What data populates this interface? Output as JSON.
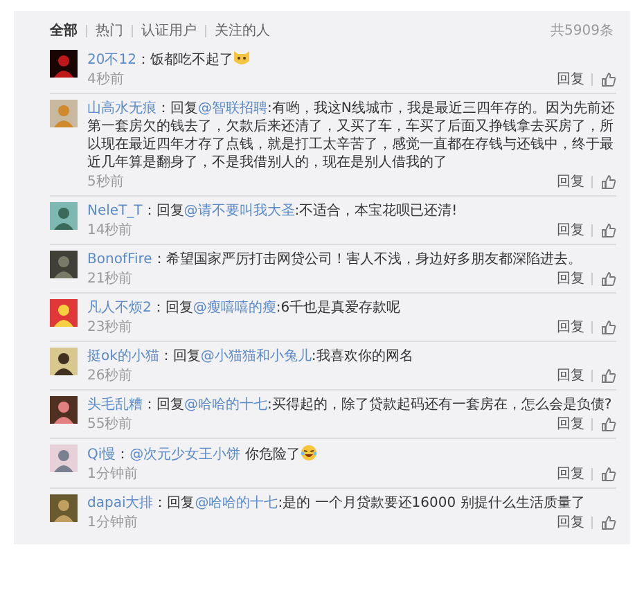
{
  "tabs": [
    {
      "label": "全部",
      "selected": true
    },
    {
      "label": "热门",
      "selected": false
    },
    {
      "label": "认证用户",
      "selected": false
    },
    {
      "label": "关注的人",
      "selected": false
    }
  ],
  "total": "共5909条",
  "comments": [
    {
      "user": "20不12",
      "parts": [
        {
          "kind": "text",
          "text": "：饭都吃不起了"
        },
        {
          "kind": "catface"
        }
      ],
      "time": "4秒前",
      "reply": "回复"
    },
    {
      "user": "山高水无痕",
      "parts": [
        {
          "kind": "text",
          "text": "：回复"
        },
        {
          "kind": "mention",
          "text": "@智联招聘"
        },
        {
          "kind": "text",
          "text": ":有哟，我这N线城市，我是最近三四年存的。因为先前还第一套房欠的钱去了，欠款后来还清了，又买了车，车买了后面又挣钱拿去买房了，所以现在最近四年才存了点钱，就是打工太辛苦了，感觉一直都在存钱与还钱中，终于最近几年算是翻身了，不是我借别人的，现在是别人借我的了"
        }
      ],
      "time": "5秒前",
      "reply": "回复"
    },
    {
      "user": "NeleT_T",
      "parts": [
        {
          "kind": "text",
          "text": "：回复"
        },
        {
          "kind": "mention",
          "text": "@请不要叫我大圣"
        },
        {
          "kind": "text",
          "text": ":不适合，本宝花呗已还清!"
        }
      ],
      "time": "14秒前",
      "reply": "回复"
    },
    {
      "user": "BonofFire",
      "parts": [
        {
          "kind": "text",
          "text": "：希望国家严厉打击网贷公司！害人不浅，身边好多朋友都深陷进去。"
        }
      ],
      "time": "21秒前",
      "reply": "回复"
    },
    {
      "user": "凡人不烦2",
      "parts": [
        {
          "kind": "text",
          "text": "：回复"
        },
        {
          "kind": "mention",
          "text": "@瘦嘻嘻的瘦"
        },
        {
          "kind": "text",
          "text": ":6千也是真爱存款呢"
        }
      ],
      "time": "23秒前",
      "reply": "回复"
    },
    {
      "user": "挺ok的小猫",
      "parts": [
        {
          "kind": "text",
          "text": "：回复"
        },
        {
          "kind": "mention",
          "text": "@小猫猫和小兔儿"
        },
        {
          "kind": "text",
          "text": ":我喜欢你的网名"
        }
      ],
      "time": "26秒前",
      "reply": "回复"
    },
    {
      "user": "头毛乱糟",
      "parts": [
        {
          "kind": "text",
          "text": "：回复"
        },
        {
          "kind": "mention",
          "text": "@哈哈的十七"
        },
        {
          "kind": "text",
          "text": ":买得起的，除了贷款起码还有一套房在，怎么会是负债?"
        }
      ],
      "time": "55秒前",
      "reply": "回复"
    },
    {
      "user": "Qi慢",
      "parts": [
        {
          "kind": "text",
          "text": "："
        },
        {
          "kind": "mention",
          "text": "@次元少女王小饼"
        },
        {
          "kind": "text",
          "text": " 你危险了"
        },
        {
          "kind": "laughface"
        }
      ],
      "time": "1分钟前",
      "reply": "回复"
    },
    {
      "user": "dapai大排",
      "parts": [
        {
          "kind": "text",
          "text": "：回复"
        },
        {
          "kind": "mention",
          "text": "@哈哈的十七"
        },
        {
          "kind": "text",
          "text": ":是的 一个月贷款要还16000 别提什么生活质量了"
        }
      ],
      "time": "1分钟前",
      "reply": "回复"
    }
  ]
}
